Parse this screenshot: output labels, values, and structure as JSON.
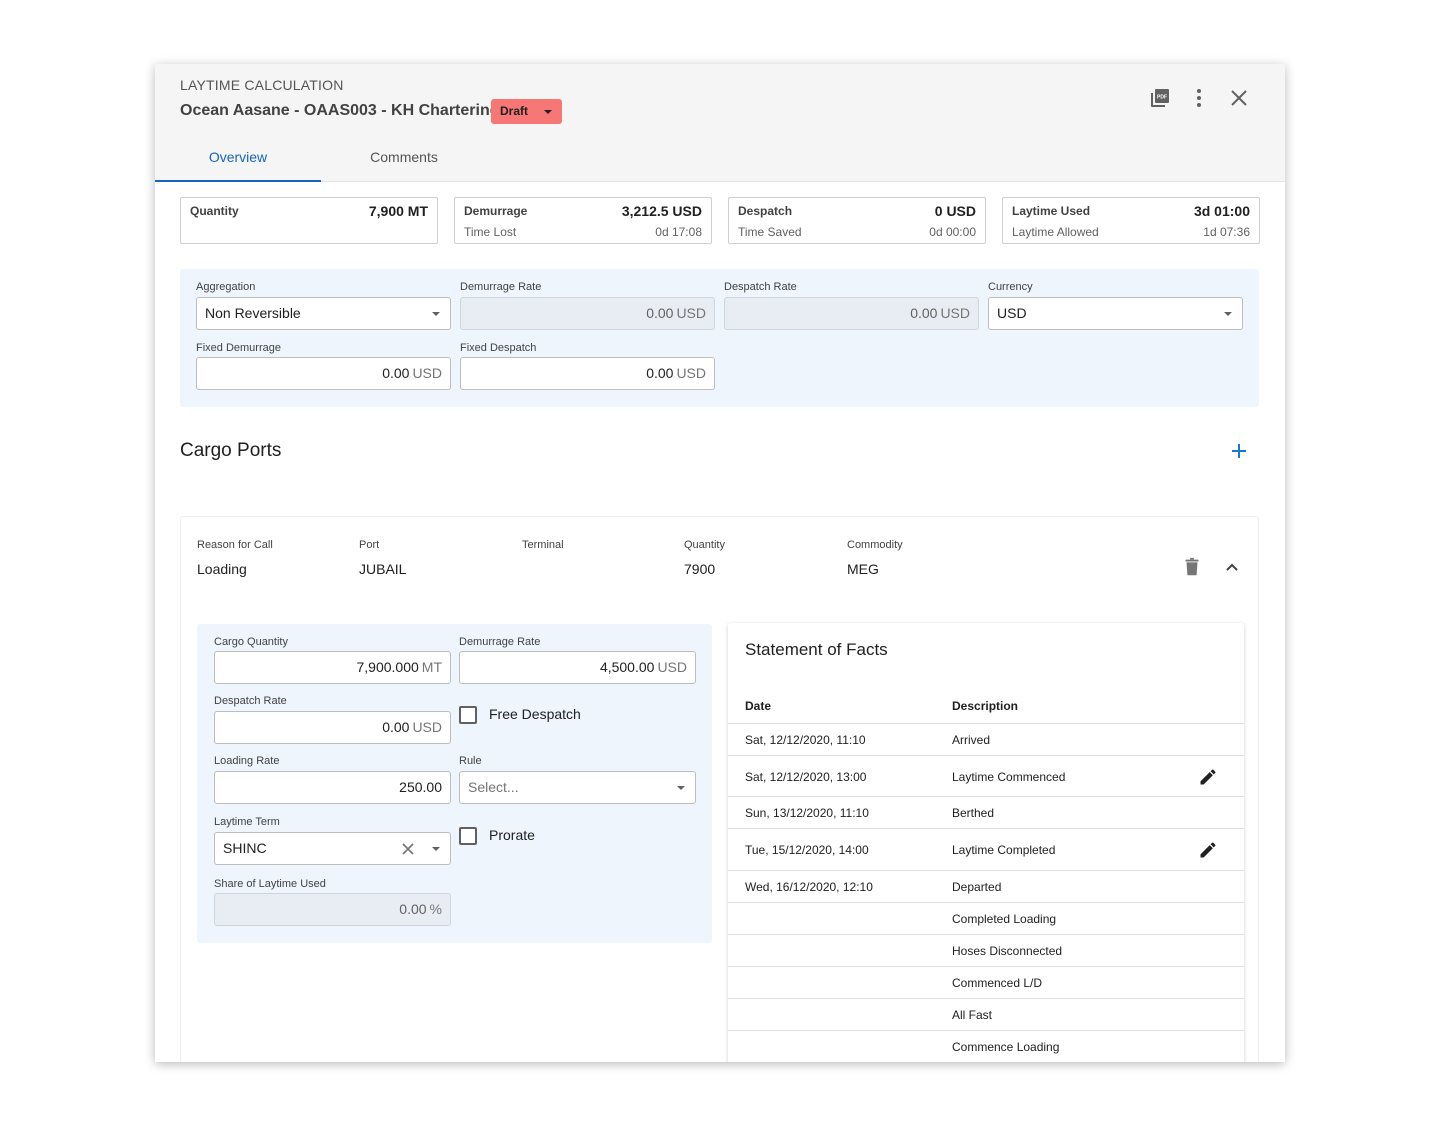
{
  "header": {
    "title": "LAYTIME CALCULATION",
    "subtitle": "Ocean Aasane - OAAS003 - KH Chartering",
    "status": "Draft",
    "status_color": "#f77676",
    "icons": [
      "pdf-icon",
      "more-vert-icon",
      "close-icon"
    ]
  },
  "tabs": [
    {
      "label": "Overview",
      "active": true
    },
    {
      "label": "Comments",
      "active": false
    }
  ],
  "summary": [
    {
      "label": "Quantity",
      "value": "7,900 MT",
      "sub_label": "",
      "sub_value": ""
    },
    {
      "label": "Demurrage",
      "value": "3,212.5 USD",
      "sub_label": "Time Lost",
      "sub_value": "0d 17:08"
    },
    {
      "label": "Despatch",
      "value": "0 USD",
      "sub_label": "Time Saved",
      "sub_value": "0d 00:00"
    },
    {
      "label": "Laytime Used",
      "value": "3d 01:00",
      "sub_label": "Laytime Allowed",
      "sub_value": "1d 07:36"
    }
  ],
  "settings": {
    "aggregation": {
      "label": "Aggregation",
      "value": "Non Reversible"
    },
    "demurrage_rate": {
      "label": "Demurrage Rate",
      "value": "0.00",
      "unit": "USD"
    },
    "despatch_rate": {
      "label": "Despatch Rate",
      "value": "0.00",
      "unit": "USD"
    },
    "currency": {
      "label": "Currency",
      "value": "USD"
    },
    "fixed_demurrage": {
      "label": "Fixed Demurrage",
      "value": "0.00",
      "unit": "USD"
    },
    "fixed_despatch": {
      "label": "Fixed Despatch",
      "value": "0.00",
      "unit": "USD"
    }
  },
  "cargo_ports": {
    "title": "Cargo Ports",
    "add_icon": "plus-icon",
    "port": {
      "columns": [
        {
          "label": "Reason for Call",
          "value": "Loading"
        },
        {
          "label": "Port",
          "value": "JUBAIL"
        },
        {
          "label": "Terminal",
          "value": ""
        },
        {
          "label": "Quantity",
          "value": "7900"
        },
        {
          "label": "Commodity",
          "value": "MEG"
        }
      ],
      "form": {
        "cargo_quantity": {
          "label": "Cargo Quantity",
          "value": "7,900.000",
          "unit": "MT"
        },
        "demurrage_rate": {
          "label": "Demurrage Rate",
          "value": "4,500.00",
          "unit": "USD"
        },
        "despatch_rate": {
          "label": "Despatch Rate",
          "value": "0.00",
          "unit": "USD"
        },
        "free_despatch": {
          "label": "Free Despatch",
          "checked": false
        },
        "loading_rate": {
          "label": "Loading Rate",
          "value": "250.00"
        },
        "rule": {
          "label": "Rule",
          "placeholder": "Select..."
        },
        "laytime_term": {
          "label": "Laytime Term",
          "value": "SHINC"
        },
        "prorate": {
          "label": "Prorate",
          "checked": false
        },
        "share_used": {
          "label": "Share of Laytime Used",
          "value": "0.00",
          "unit": "%"
        }
      },
      "sof": {
        "title": "Statement of Facts",
        "headers": {
          "date": "Date",
          "description": "Description"
        },
        "rows": [
          {
            "date": "Sat, 12/12/2020, 11:10",
            "description": "Arrived",
            "editable": false
          },
          {
            "date": "Sat, 12/12/2020, 13:00",
            "description": "Laytime Commenced",
            "editable": true
          },
          {
            "date": "Sun, 13/12/2020, 11:10",
            "description": "Berthed",
            "editable": false
          },
          {
            "date": "Tue, 15/12/2020, 14:00",
            "description": "Laytime Completed",
            "editable": true
          },
          {
            "date": "Wed, 16/12/2020, 12:10",
            "description": "Departed",
            "editable": false
          },
          {
            "date": "",
            "description": "Completed Loading",
            "editable": false
          },
          {
            "date": "",
            "description": "Hoses Disconnected",
            "editable": false
          },
          {
            "date": "",
            "description": "Commenced L/D",
            "editable": false
          },
          {
            "date": "",
            "description": "All Fast",
            "editable": false
          },
          {
            "date": "",
            "description": "Commence Loading",
            "editable": false
          }
        ]
      }
    }
  }
}
